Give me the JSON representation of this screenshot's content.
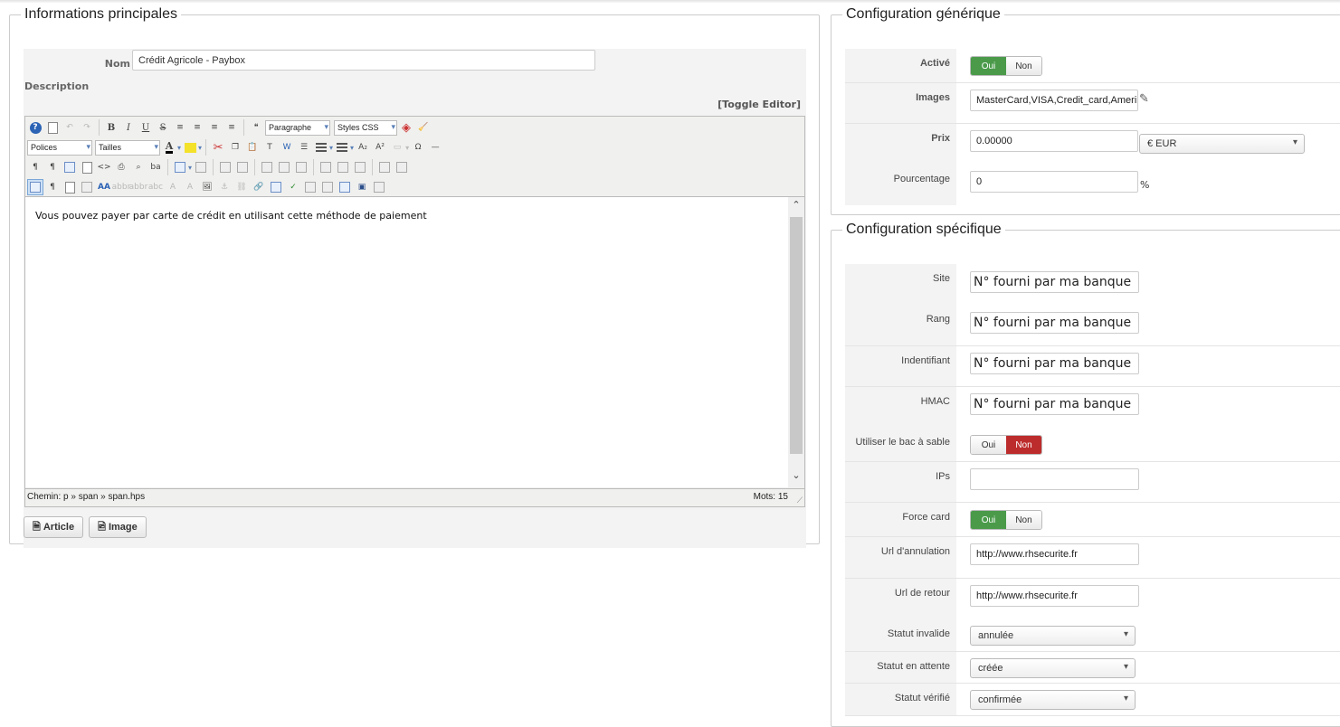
{
  "main": {
    "legend": "Informations principales",
    "nom_label": "Nom",
    "nom_value": "Crédit Agricole - Paybox",
    "description_label": "Description",
    "toggle_editor": "[Toggle Editor]",
    "toolbar": {
      "paragraph_select": "Paragraphe",
      "styles_select": "Styles CSS",
      "fonts_select": "Polices",
      "sizes_select": "Tailles"
    },
    "content_text": "Vous pouvez payer par carte de crédit en utilisant cette méthode de paiement",
    "path_text": "Chemin: p » span » span.hps",
    "words_text": "Mots: 15",
    "article_button": "Article",
    "image_button": "Image"
  },
  "generic": {
    "legend": "Configuration générique",
    "active_label": "Activé",
    "active_yes": "Oui",
    "active_no": "Non",
    "images_label": "Images",
    "images_value": "MasterCard,VISA,Credit_card,Ameri",
    "price_label": "Prix",
    "price_value": "0.00000",
    "currency_value": "€ EUR",
    "percent_label": "Pourcentage",
    "percent_value": "0",
    "percent_sign": "%"
  },
  "specific": {
    "legend": "Configuration spécifique",
    "site_label": "Site",
    "site_placeholder": "N° fourni par ma banque",
    "rang_label": "Rang",
    "rang_placeholder": "N° fourni par ma banque",
    "ident_label": "Indentifiant",
    "ident_placeholder": "N° fourni par ma banque",
    "hmac_label": "HMAC",
    "hmac_placeholder": "N° fourni par ma banque",
    "sandbox_label": "Utiliser le bac à sable",
    "sandbox_yes": "Oui",
    "sandbox_no": "Non",
    "ips_label": "IPs",
    "force_label": "Force card",
    "force_yes": "Oui",
    "force_no": "Non",
    "cancel_url_label": "Url d'annulation",
    "cancel_url_value": "http://www.rhsecurite.fr",
    "return_url_label": "Url de retour",
    "return_url_value": "http://www.rhsecurite.fr",
    "invalid_label": "Statut invalide",
    "invalid_value": "annulée",
    "pending_label": "Statut en attente",
    "pending_value": "créée",
    "verified_label": "Statut vérifié",
    "verified_value": "confirmée"
  },
  "colors": {
    "toggle_on_green": "#4a9a4a",
    "toggle_on_red": "#bd2c2c"
  }
}
